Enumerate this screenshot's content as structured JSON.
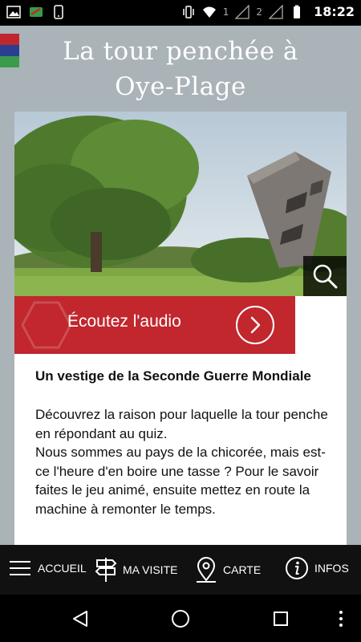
{
  "status_bar": {
    "time": "18:22",
    "sim1": "1",
    "sim2": "2",
    "icons": [
      "gallery-icon",
      "app-badge-icon",
      "phone-outline-icon",
      "vibrate-icon",
      "wifi-icon",
      "signal-icon",
      "battery-icon"
    ]
  },
  "header": {
    "title_line1": "La tour penchée à",
    "title_line2": "Oye-Plage",
    "flag_colors": [
      "#c0272d",
      "#2c3e8f",
      "#3a9b4a"
    ]
  },
  "card": {
    "audio_label": "Écoutez l'audio",
    "subtitle": "Un vestige de la Seconde Guerre Mondiale",
    "paragraph_line1": "Découvrez la raison pour laquelle la tour penche en répondant au quiz.",
    "paragraph_line2": "Nous sommes au pays de la chicorée, mais est-ce l'heure d'en boire une tasse ? Pour le savoir faites le jeu animé, ensuite mettez en route la machine à remonter le temps."
  },
  "bottom_nav": {
    "items": [
      {
        "label": "ACCUEIL",
        "icon": "menu-icon"
      },
      {
        "label": "MA VISITE",
        "icon": "signpost-icon"
      },
      {
        "label": "CARTE",
        "icon": "map-pin-icon"
      },
      {
        "label": "INFOS",
        "icon": "info-icon"
      }
    ]
  },
  "colors": {
    "background": "#aab3b8",
    "accent_red": "#c1272d",
    "nav_bg": "#111111"
  }
}
